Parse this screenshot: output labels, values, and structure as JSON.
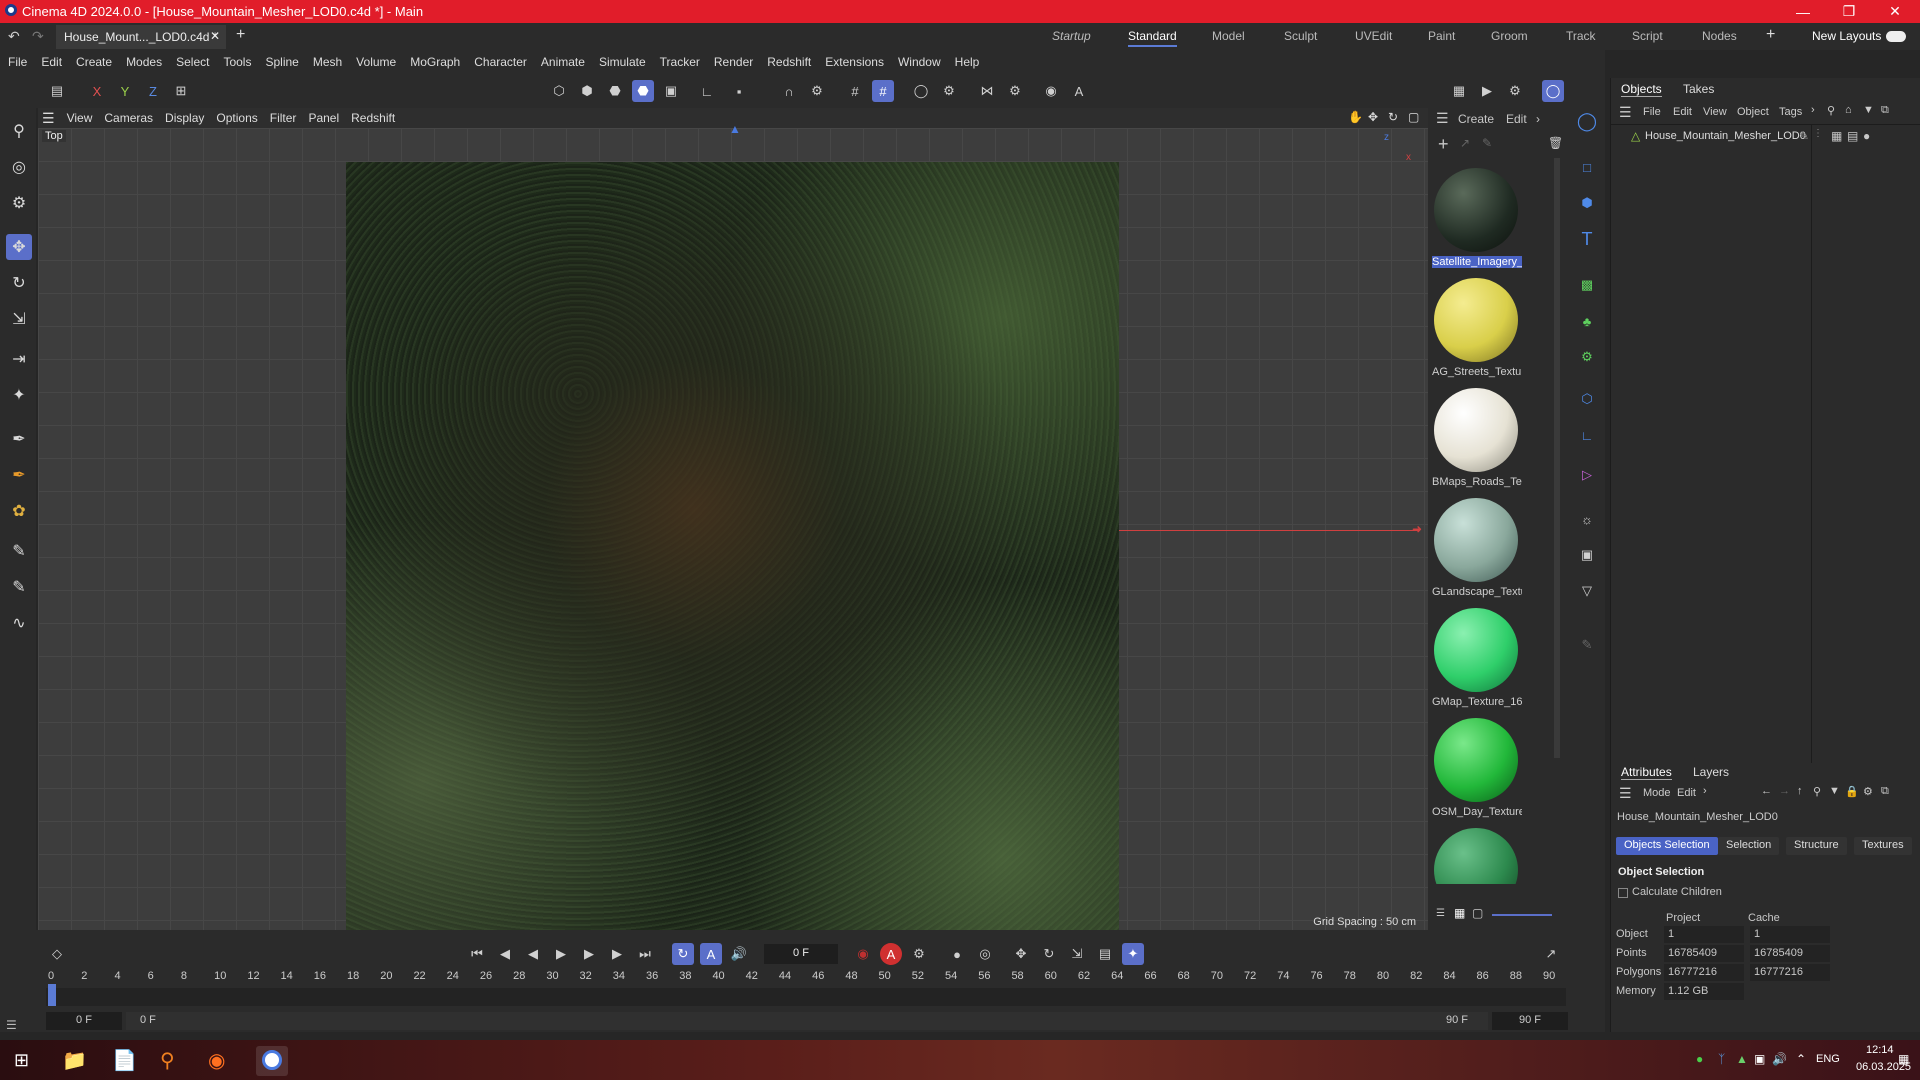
{
  "window": {
    "title": "Cinema 4D 2024.0.0 - [House_Mountain_Mesher_LOD0.c4d *] - Main"
  },
  "doc_tab": {
    "label": "House_Mount..._LOD0.c4d *"
  },
  "layouts": [
    "Startup",
    "Standard",
    "Model",
    "Sculpt",
    "UVEdit",
    "Paint",
    "Groom",
    "Track",
    "Script",
    "Nodes"
  ],
  "new_layouts": "New Layouts",
  "menu": [
    "File",
    "Edit",
    "Create",
    "Modes",
    "Select",
    "Tools",
    "Spline",
    "Mesh",
    "Volume",
    "MoGraph",
    "Character",
    "Animate",
    "Simulate",
    "Tracker",
    "Render",
    "Redshift",
    "Extensions",
    "Window",
    "Help"
  ],
  "axis": {
    "x": "X",
    "y": "Y",
    "z": "Z"
  },
  "viewport": {
    "menu": [
      "View",
      "Cameras",
      "Display",
      "Options",
      "Filter",
      "Panel",
      "Redshift"
    ],
    "name": "Top",
    "grid_spacing": "Grid Spacing : 50 cm"
  },
  "material_panel": {
    "menu": [
      "Create",
      "Edit"
    ],
    "materials": [
      {
        "name": "Satellite_Imagery_",
        "color": "#1f2a22"
      },
      {
        "name": "AG_Streets_Textur",
        "color": "#d9cf4a"
      },
      {
        "name": "BMaps_Roads_Tex",
        "color": "#e6e2d4"
      },
      {
        "name": "GLandscape_Textu",
        "color": "#8aa89c"
      },
      {
        "name": "GMap_Texture_16",
        "color": "#2fcf6a"
      },
      {
        "name": "OSM_Day_Texture",
        "color": "#22b83a"
      },
      {
        "name": "",
        "color": "#2d8a4e"
      }
    ]
  },
  "objects": {
    "tabs": [
      "Objects",
      "Takes"
    ],
    "menu": [
      "File",
      "Edit",
      "View",
      "Object",
      "Tags"
    ],
    "items": [
      "House_Mountain_Mesher_LOD0"
    ]
  },
  "attributes": {
    "tabs": [
      "Attributes",
      "Layers"
    ],
    "menu": [
      "Mode",
      "Edit"
    ],
    "object_name": "House_Mountain_Mesher_LOD0",
    "buttons": [
      "Objects Selection",
      "Selection",
      "Structure",
      "Textures"
    ],
    "section": "Object Selection",
    "calc_children": "Calculate Children",
    "col_project": "Project",
    "col_cache": "Cache",
    "rows": [
      {
        "label": "Object",
        "project": "1",
        "cache": "1"
      },
      {
        "label": "Points",
        "project": "16785409",
        "cache": "16785409"
      },
      {
        "label": "Polygons",
        "project": "16777216",
        "cache": "16777216"
      },
      {
        "label": "Memory",
        "project": "1.12 GB",
        "cache": ""
      }
    ]
  },
  "timeline": {
    "frame": "0 F",
    "ticks": [
      "0",
      "2",
      "4",
      "6",
      "8",
      "10",
      "12",
      "14",
      "16",
      "18",
      "20",
      "22",
      "24",
      "26",
      "28",
      "30",
      "32",
      "34",
      "36",
      "38",
      "40",
      "42",
      "44",
      "46",
      "48",
      "50",
      "52",
      "54",
      "56",
      "58",
      "60",
      "62",
      "64",
      "66",
      "68",
      "70",
      "72",
      "74",
      "76",
      "78",
      "80",
      "82",
      "84",
      "86",
      "88",
      "90"
    ],
    "start_a": "0 F",
    "start_b": "0 F",
    "end_a": "90 F",
    "end_b": "90 F"
  },
  "taskbar": {
    "lang": "ENG",
    "time": "12:14",
    "date": "06.03.2025"
  }
}
